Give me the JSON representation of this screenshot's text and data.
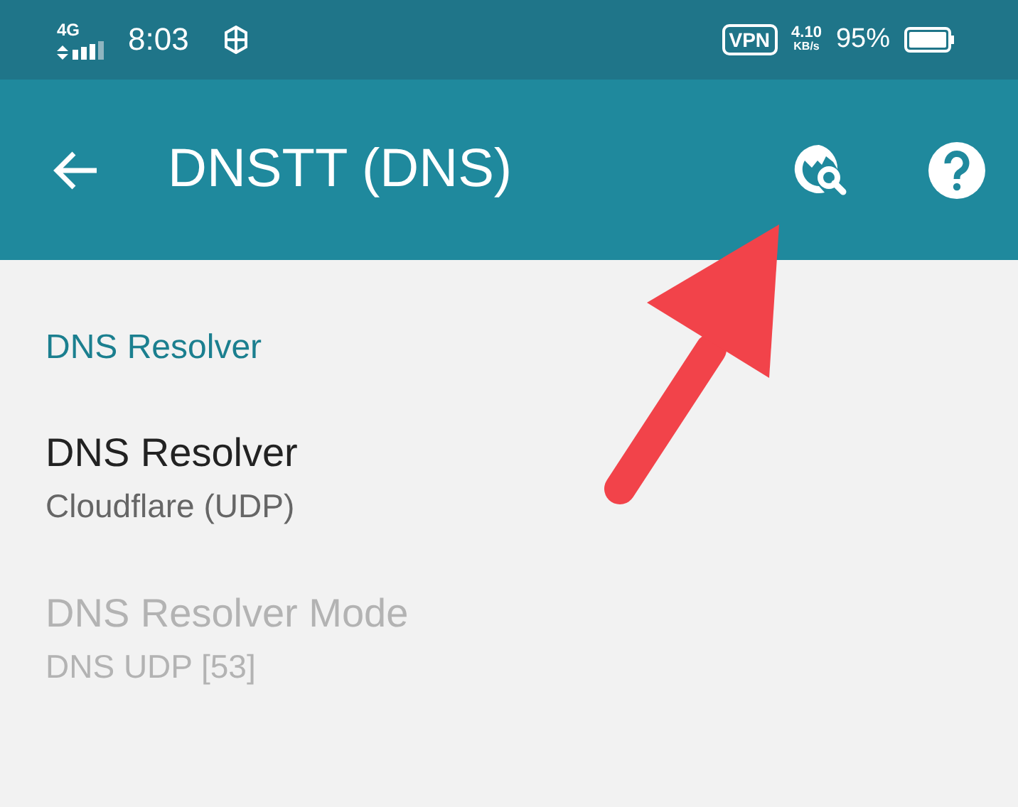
{
  "status_bar": {
    "network": "4G",
    "time": "8:03",
    "vpn": "VPN",
    "speed": "4.10",
    "speed_unit": "KB/s",
    "battery": "95%"
  },
  "toolbar": {
    "title": "DNSTT (DNS)"
  },
  "section": {
    "title": "DNS Resolver"
  },
  "preferences": [
    {
      "title": "DNS Resolver",
      "summary": "Cloudflare (UDP)",
      "disabled": false
    },
    {
      "title": "DNS Resolver Mode",
      "summary": "DNS UDP [53]",
      "disabled": true
    }
  ]
}
